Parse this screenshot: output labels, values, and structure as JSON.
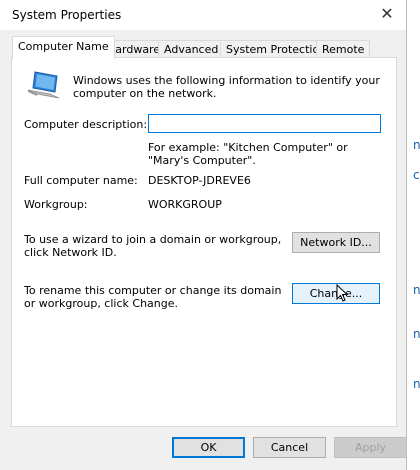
{
  "window": {
    "title": "System Properties",
    "close_glyph": "✕"
  },
  "tabs": [
    {
      "label": "Computer Name",
      "active": true
    },
    {
      "label": "Hardware",
      "active": false
    },
    {
      "label": "Advanced",
      "active": false
    },
    {
      "label": "System Protection",
      "active": false
    },
    {
      "label": "Remote",
      "active": false
    }
  ],
  "panel": {
    "intro": "Windows uses the following information to identify your computer on the network.",
    "description_label": "Computer description:",
    "description_value": "",
    "example_text": "For example: \"Kitchen Computer\" or \"Mary's Computer\".",
    "full_name_label": "Full computer name:",
    "full_name_value": "DESKTOP-JDREVE6",
    "workgroup_label": "Workgroup:",
    "workgroup_value": "WORKGROUP",
    "wizard_text": "To use a wizard to join a domain or workgroup, click Network ID.",
    "network_id_button": "Network ID...",
    "rename_text": "To rename this computer or change its domain or workgroup, click Change.",
    "change_button": "Change..."
  },
  "footer": {
    "ok": "OK",
    "cancel": "Cancel",
    "apply": "Apply"
  },
  "icons": {
    "computer": "computer-icon",
    "close": "close-icon",
    "cursor": "mouse-pointer-icon"
  }
}
